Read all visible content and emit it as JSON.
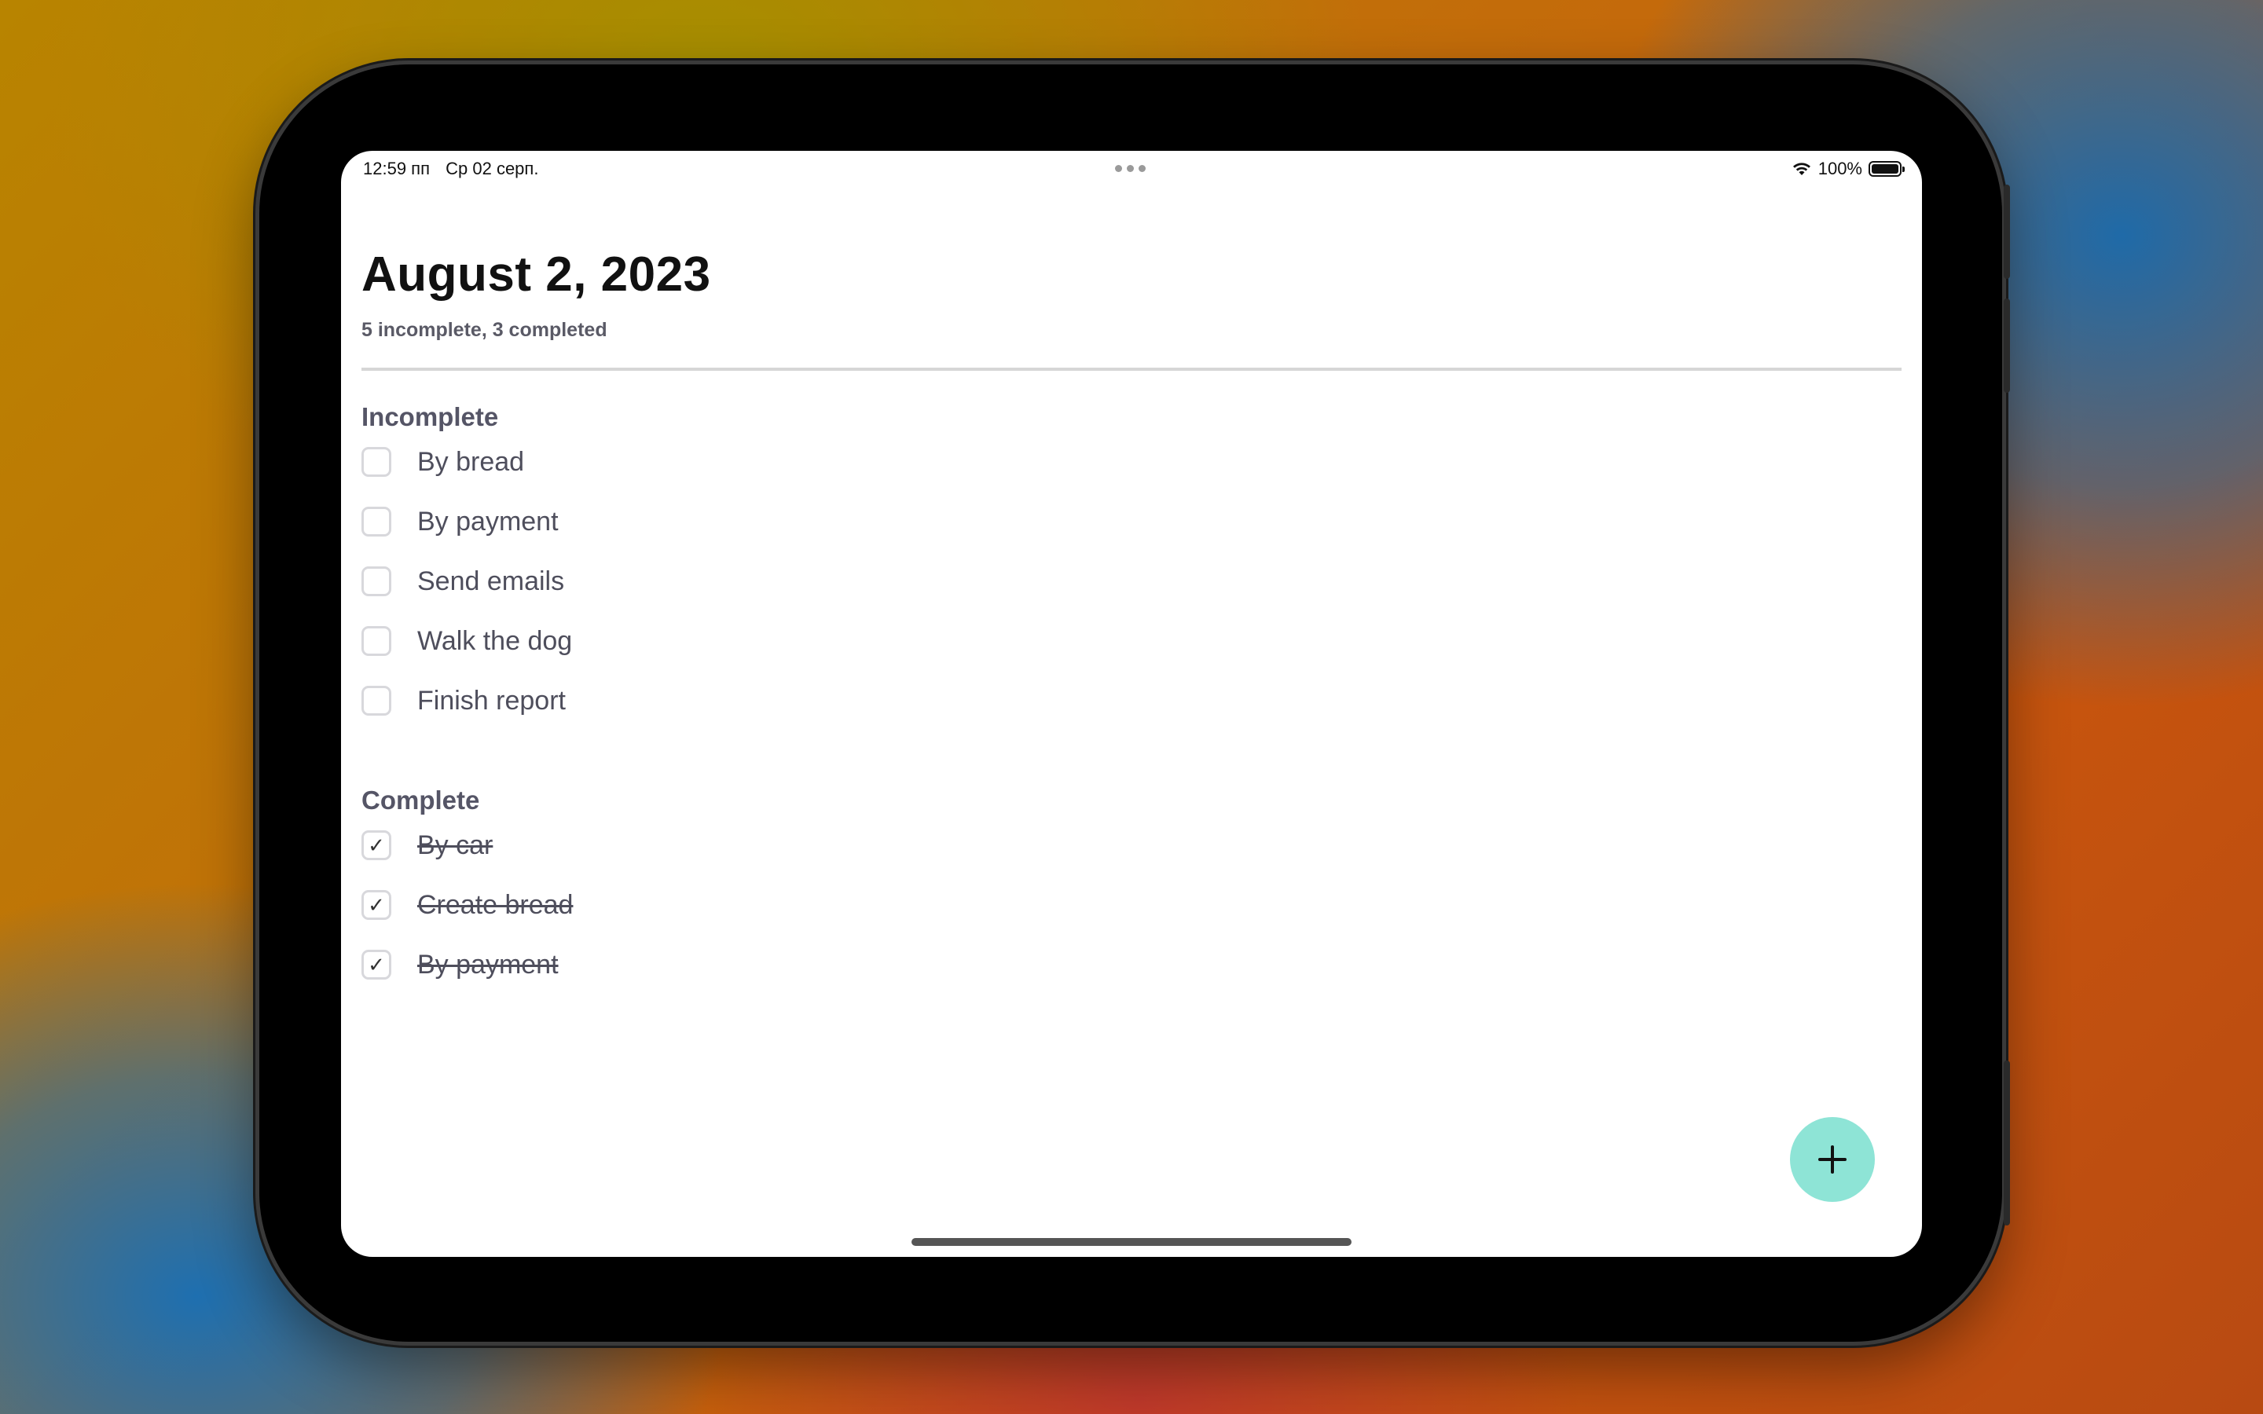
{
  "status_bar": {
    "time": "12:59 пп",
    "date": "Ср 02 серп.",
    "battery": "100%",
    "battery_level": 1.0
  },
  "header": {
    "title": "August 2, 2023",
    "summary": "5 incomplete, 3 completed"
  },
  "sections": {
    "incomplete": {
      "title": "Incomplete",
      "items": [
        {
          "label": "By bread",
          "checked": false
        },
        {
          "label": "By payment",
          "checked": false
        },
        {
          "label": "Send emails",
          "checked": false
        },
        {
          "label": "Walk the dog",
          "checked": false
        },
        {
          "label": "Finish report",
          "checked": false
        }
      ]
    },
    "complete": {
      "title": "Complete",
      "items": [
        {
          "label": "By car",
          "checked": true
        },
        {
          "label": "Create bread",
          "checked": true
        },
        {
          "label": "By payment",
          "checked": true
        }
      ]
    }
  },
  "fab": {
    "icon": "plus-icon",
    "color": "#8ee4d6"
  },
  "checkmark_glyph": "✓"
}
